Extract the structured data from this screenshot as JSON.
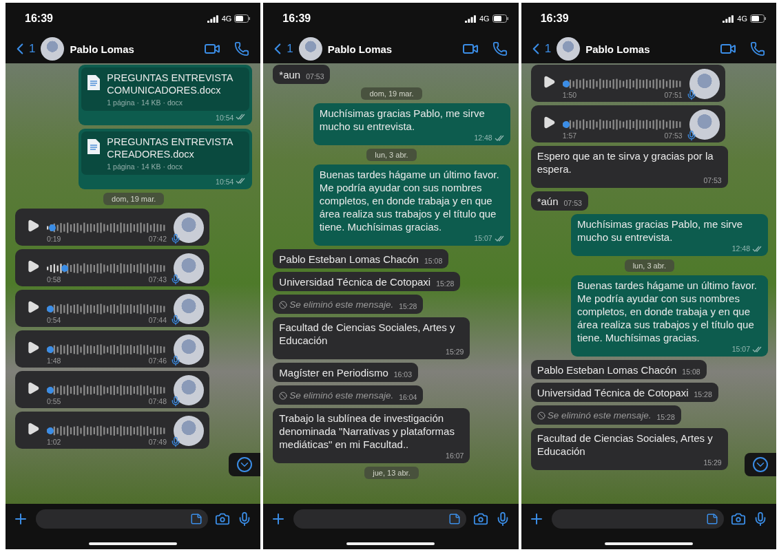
{
  "phones": [
    {
      "status_bar": {
        "time": "16:39",
        "network": "4G"
      },
      "header": {
        "back_count": "1",
        "contact": "Pablo Lomas"
      },
      "show_scroll_button": true,
      "messages": [
        {
          "kind": "document",
          "title": "PREGUNTAS ENTREVISTA COMUNICADORES.docx",
          "meta": "1 página · 14 KB · docx",
          "time": "10:54"
        },
        {
          "kind": "document",
          "title": "PREGUNTAS ENTREVISTA CREADORES.docx",
          "meta": "1 página · 14 KB · docx",
          "time": "10:54"
        },
        {
          "kind": "date",
          "text": "dom, 19 mar."
        },
        {
          "kind": "voice",
          "duration": "0:19",
          "time": "07:42",
          "level": 0.02
        },
        {
          "kind": "voice",
          "duration": "0:58",
          "time": "07:43",
          "level": 0.13
        },
        {
          "kind": "voice",
          "duration": "0:54",
          "time": "07:44",
          "level": 0
        },
        {
          "kind": "voice",
          "duration": "1:48",
          "time": "07:46",
          "level": 0
        },
        {
          "kind": "voice",
          "duration": "0:55",
          "time": "07:48",
          "level": 0
        },
        {
          "kind": "voice",
          "duration": "1:02",
          "time": "07:49",
          "level": 0
        }
      ]
    },
    {
      "status_bar": {
        "time": "16:39",
        "network": "4G"
      },
      "header": {
        "back_count": "1",
        "contact": "Pablo Lomas"
      },
      "show_scroll_button": false,
      "messages": [
        {
          "kind": "text",
          "outgoing": false,
          "text": "*aun",
          "time": "07:53"
        },
        {
          "kind": "date",
          "text": "dom, 19 mar."
        },
        {
          "kind": "text",
          "outgoing": true,
          "text": "Muchísimas gracias Pablo, me sirve mucho su entrevista.",
          "time": "12:48"
        },
        {
          "kind": "date",
          "text": "lun, 3 abr."
        },
        {
          "kind": "text",
          "outgoing": true,
          "text": "Buenas tardes hágame un último favor.\nMe podría ayudar con sus nombres completos, en donde trabaja y en que área realiza sus trabajos y el título que tiene. Muchísimas gracias.",
          "time": "15:07"
        },
        {
          "kind": "text",
          "outgoing": false,
          "text": "Pablo Esteban Lomas Chacón",
          "time": "15:08"
        },
        {
          "kind": "text",
          "outgoing": false,
          "text": "Universidad Técnica de Cotopaxi",
          "time": "15:28"
        },
        {
          "kind": "deleted",
          "text": "Se eliminó este mensaje.",
          "time": "15:28"
        },
        {
          "kind": "text",
          "outgoing": false,
          "text": "Facultad de Ciencias Sociales, Artes y Educación",
          "time": "15:29"
        },
        {
          "kind": "text",
          "outgoing": false,
          "text": "Magíster en Periodismo",
          "time": "16:03"
        },
        {
          "kind": "deleted",
          "text": "Se eliminó este mensaje.",
          "time": "16:04"
        },
        {
          "kind": "text",
          "outgoing": false,
          "text": "Trabajo la sublínea de investigación denominada \"Narrativas y plataformas mediáticas\" en mi Facultad..",
          "time": "16:07"
        },
        {
          "kind": "date",
          "text": "jue, 13 abr."
        }
      ]
    },
    {
      "status_bar": {
        "time": "16:39",
        "network": "4G"
      },
      "header": {
        "back_count": "1",
        "contact": "Pablo Lomas"
      },
      "show_scroll_button": true,
      "messages": [
        {
          "kind": "voice",
          "duration": "1:50",
          "time": "07:51",
          "level": 0
        },
        {
          "kind": "voice",
          "duration": "1:57",
          "time": "07:53",
          "level": 0
        },
        {
          "kind": "text",
          "outgoing": false,
          "text": "Espero que an te sirva y gracias por la espera.",
          "time": "07:53"
        },
        {
          "kind": "text",
          "outgoing": false,
          "text": "*aún",
          "time": "07:53"
        },
        {
          "kind": "text",
          "outgoing": true,
          "text": "Muchísimas gracias Pablo, me sirve mucho su entrevista.",
          "time": "12:48"
        },
        {
          "kind": "date",
          "text": "lun, 3 abr."
        },
        {
          "kind": "text",
          "outgoing": true,
          "text": "Buenas tardes hágame un último favor.\nMe podría ayudar con sus nombres completos, en donde trabaja y en que área realiza sus trabajos y el título que tiene. Muchísimas gracias.",
          "time": "15:07"
        },
        {
          "kind": "text",
          "outgoing": false,
          "text": "Pablo Esteban Lomas Chacón",
          "time": "15:08"
        },
        {
          "kind": "text",
          "outgoing": false,
          "text": "Universidad Técnica de Cotopaxi",
          "time": "15:28"
        },
        {
          "kind": "deleted",
          "text": "Se eliminó este mensaje.",
          "time": "15:28"
        },
        {
          "kind": "text",
          "outgoing": false,
          "text": "Facultad de Ciencias Sociales, Artes y Educación",
          "time": "15:29"
        }
      ]
    }
  ]
}
